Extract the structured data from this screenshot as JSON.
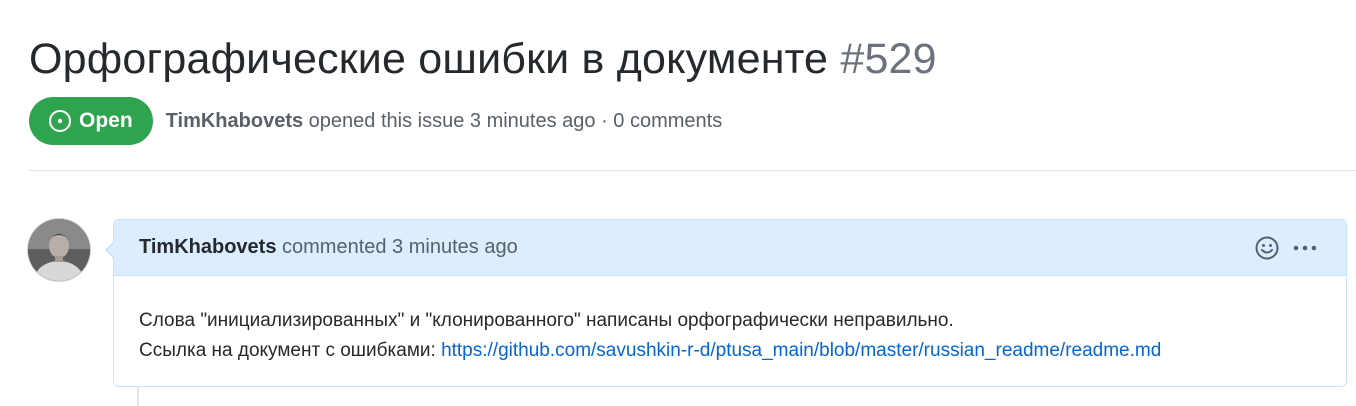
{
  "issue": {
    "title": "Орфографические ошибки в документе",
    "number": "#529",
    "state_label": "Open",
    "author": "TimKhabovets",
    "meta_suffix": " opened this issue 3 minutes ago · 0 comments"
  },
  "comment": {
    "author": "TimKhabovets",
    "header_suffix": " commented 3 minutes ago",
    "body_line1": "Слова \"инициализированных\" и \"клонированного\" написаны орфографически неправильно.",
    "body_line2_prefix": "Ссылка на документ с ошибками: ",
    "link_text": "https://github.com/savushkin-r-d/ptusa_main/blob/master/russian_readme/readme.md"
  },
  "icons": {
    "state": "issue-opened-icon",
    "reaction": "smiley-icon",
    "menu": "kebab-horizontal-icon"
  },
  "colors": {
    "open_green": "#2ea44f",
    "comment_header_bg": "#dbedff",
    "link_blue": "#0366d6"
  }
}
